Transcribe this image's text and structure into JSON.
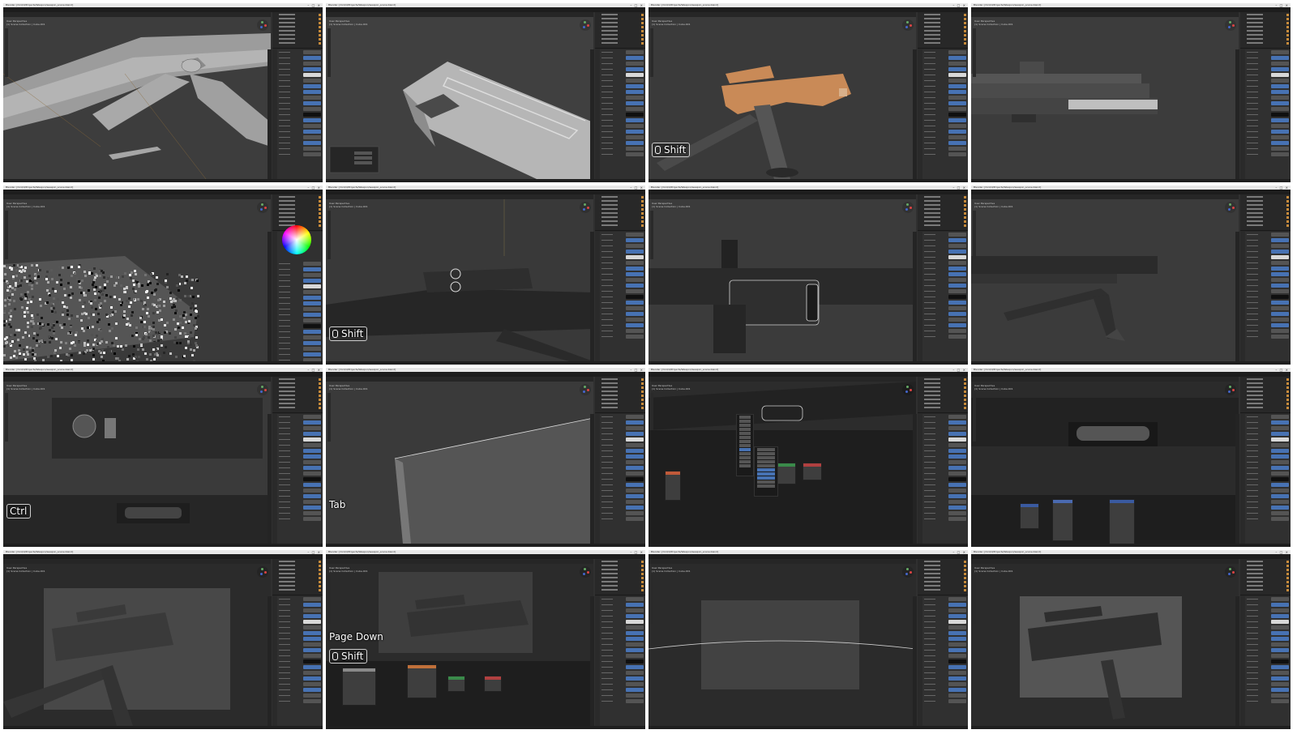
{
  "app": {
    "title_text": "Blender [/mnt/d/Projects/Weapon/weapon_scene.blend]",
    "window_controls": "– □ ×",
    "menus": [
      "File",
      "Edit",
      "Render",
      "Window",
      "Help"
    ],
    "workspaces": [
      "Layout",
      "Modeling",
      "Sculpting",
      "UV Editing",
      "Texture Paint",
      "Shading",
      "Animation",
      "Rendering",
      "Compositing",
      "Scripting"
    ],
    "active_workspace": "Layout",
    "view_menus": [
      "Object Mode",
      "View",
      "Select",
      "Add",
      "Object"
    ],
    "overlay_info": [
      "User Perspective",
      "(1) Scene Collection | Cube.001"
    ],
    "status_text": "Select   Box Select   Rotate View   Object Context Menu"
  },
  "tiles": [
    {
      "key_label": "",
      "kind": "viewport-grey"
    },
    {
      "key_label": "",
      "kind": "viewport-block"
    },
    {
      "key_label": "Shift",
      "kind": "viewport-orange"
    },
    {
      "key_label": "",
      "kind": "viewport-side"
    },
    {
      "key_label": "",
      "kind": "viewport-noise"
    },
    {
      "key_label": "Shift",
      "kind": "viewport-gun"
    },
    {
      "key_label": "",
      "kind": "viewport-closeup"
    },
    {
      "key_label": "",
      "kind": "viewport-bipod"
    },
    {
      "key_label": "Ctrl",
      "kind": "viewport-sight"
    },
    {
      "key_label": "Tab",
      "kind": "viewport-plate"
    },
    {
      "key_label": "",
      "kind": "node-editor"
    },
    {
      "key_label": "",
      "kind": "node-editor-2"
    },
    {
      "key_label": "",
      "kind": "camera-frame"
    },
    {
      "key_label": "Page Down",
      "key_label_2": "Shift",
      "kind": "camera-node"
    },
    {
      "key_label": "",
      "kind": "camera-empty"
    },
    {
      "key_label": "",
      "kind": "camera-render"
    }
  ],
  "colors": {
    "accent_blue": "#4772b3",
    "selection_orange": "#e0833a",
    "viewport_bg": "#3b3b3b",
    "panel_bg": "#303030"
  }
}
